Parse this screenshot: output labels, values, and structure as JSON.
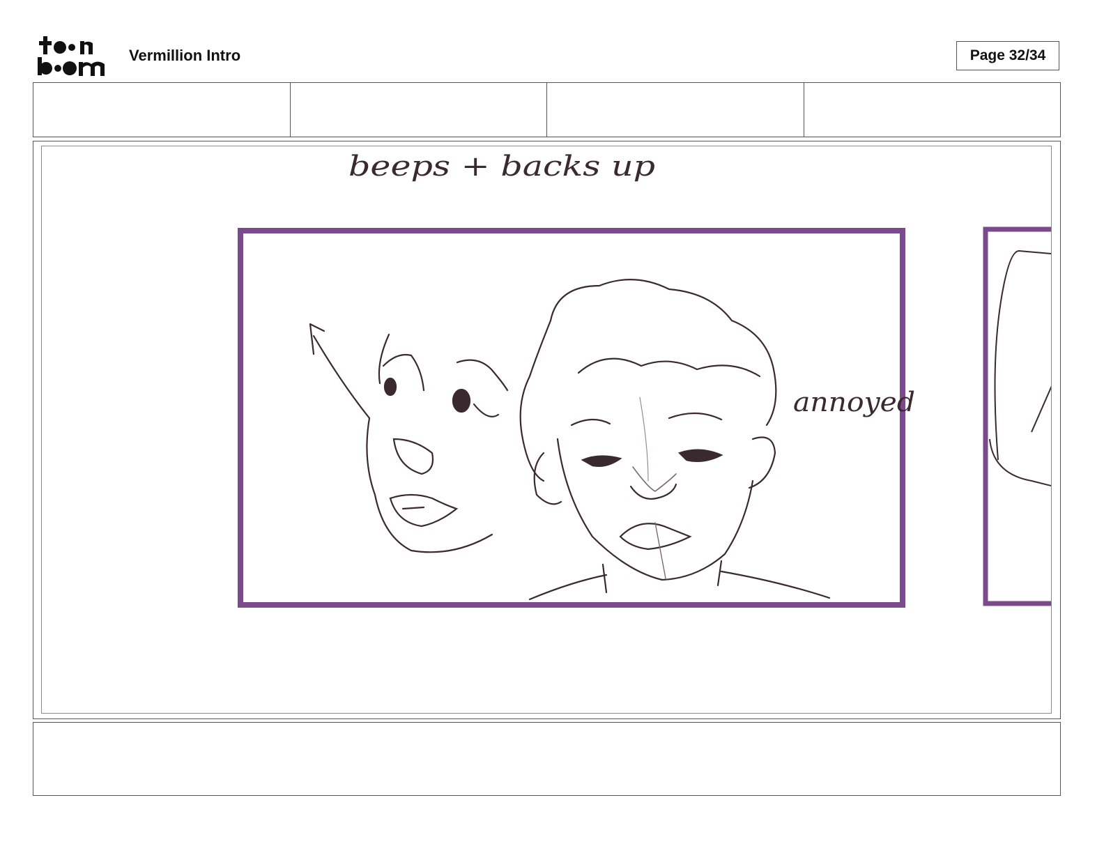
{
  "header": {
    "logo_text": "toon boom",
    "project_title": "Vermillion Intro",
    "page_number": "Page 32/34"
  },
  "info_row": {
    "cells": [
      "",
      "",
      "",
      ""
    ]
  },
  "panel": {
    "annotations": {
      "top_note": "beeps + backs up",
      "side_note": "annoyed"
    },
    "frame_color": "#7a4a8c",
    "line_color": "#3a2a30"
  },
  "notes": {
    "text": ""
  }
}
